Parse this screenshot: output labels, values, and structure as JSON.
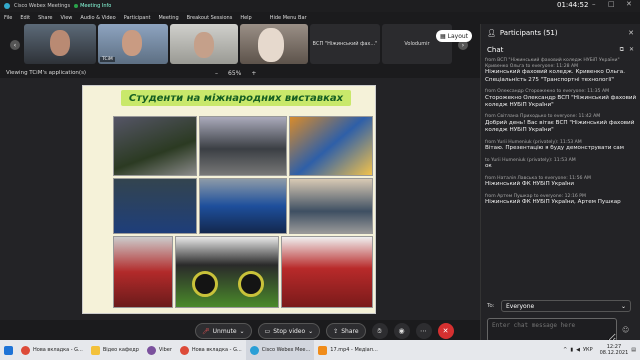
{
  "app": {
    "title": "Cisco Webex Meetings",
    "meeting_info": "Meeting Info",
    "time": "01:44:52"
  },
  "menu": [
    "File",
    "Edit",
    "Share",
    "View",
    "Audio & Video",
    "Participant",
    "Meeting",
    "Breakout Sessions",
    "Help"
  ],
  "menu_hide": "Hide Menu Bar",
  "thumbs": [
    {
      "name": ""
    },
    {
      "name": "TCiM"
    },
    {
      "name": ""
    },
    {
      "name": ""
    },
    {
      "name": "ВСП \"Ніжинський фах...\""
    },
    {
      "name": "Volodumir"
    }
  ],
  "layout_label": "Layout",
  "viewing_text": "Viewing TCiM's application(s)",
  "zoom": {
    "minus": "–",
    "value": "65%",
    "plus": "+"
  },
  "slide": {
    "title": "Студенти на міжнародних виставках"
  },
  "controls": {
    "unmute": "Unmute",
    "stop_video": "Stop video",
    "share": "Share"
  },
  "participants": {
    "label": "Participants (51)"
  },
  "chat": {
    "label": "Chat",
    "messages": [
      {
        "from": "from ВСП \"Ніжинський фаховий коледж НУБіП України\" Кривенко Ольга to everyone: 11:28 AM",
        "body": "Ніжинський фаховий коледж. Кривенко Ольга. Спеціальність 275 \"Транспортні технології\""
      },
      {
        "from": "from Олександр Сторожекно to everyone: 11:35 AM",
        "body": "Сторожекно Олександр ВСП \"Ніжинський фаховий коледж НУБіП України\""
      },
      {
        "from": "from Світлана Приходько to everyone: 11:42 AM",
        "body": "Добрий день! Вас вітає ВСП \"Ніжинський фаховий коледж НУБіП України\""
      },
      {
        "from": "from Yurii Humeniuk (privately): 11:53 AM",
        "body": "Вітаю. Презентацію я буду демонструвати сам"
      },
      {
        "from": "to Yurii Humeniuk (privately): 11:53 AM",
        "body": "ок"
      },
      {
        "from": "from Наталія Лавська to everyone: 11:56 AM",
        "body": "Ніжинський ФК НУБіП України"
      },
      {
        "from": "from Артем Пушкар to everyone: 12:16 PM",
        "body": "Ніжинський ФК НУБіП України, Артем Пушкар"
      }
    ],
    "to_label": "To:",
    "to_value": "Everyone",
    "input_placeholder": "Enter chat message here"
  },
  "taskbar": {
    "items": [
      "Нова вкладка - G...",
      "Відео кафедр",
      "Viber",
      "Нова вкладка - G...",
      "Cisco Webex Mee...",
      "17.mp4 - Медіап..."
    ],
    "lang": "УКР",
    "time": "12:27",
    "date": "08.12.2021"
  }
}
